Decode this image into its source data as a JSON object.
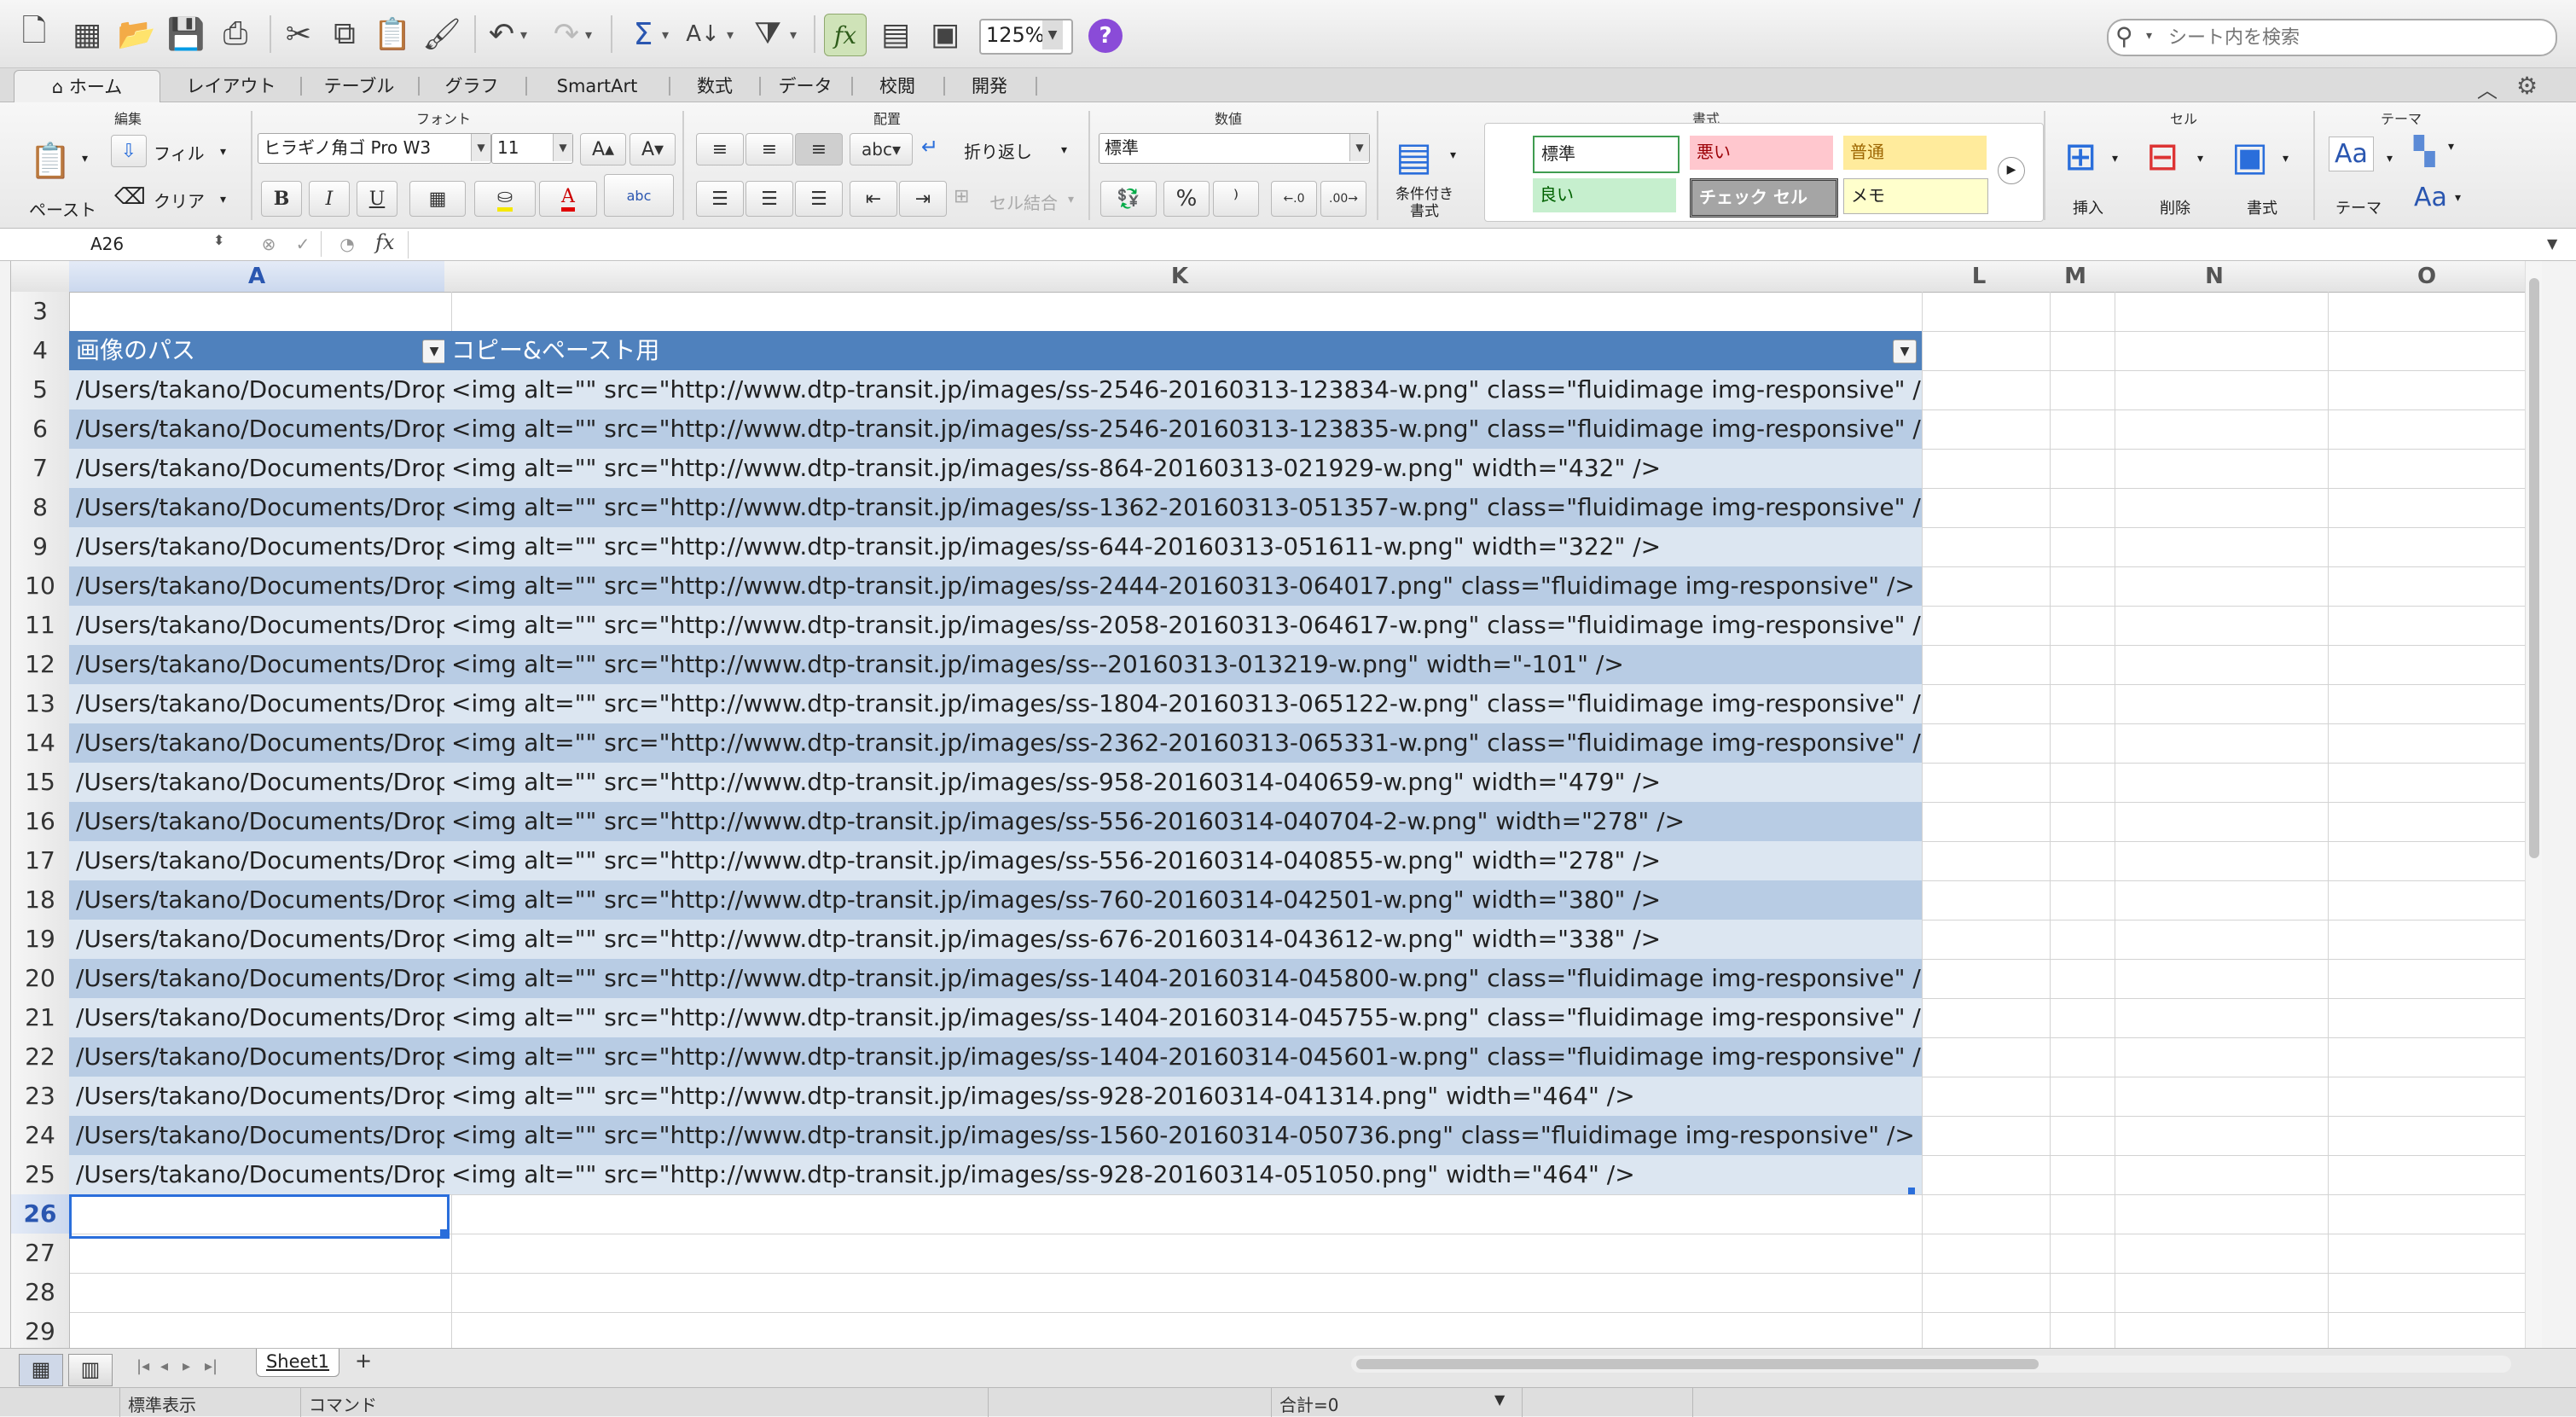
{
  "toolbar": {
    "zoom": "125%",
    "search_placeholder": "シート内を検索",
    "help": "?"
  },
  "tabs": [
    "ホーム",
    "レイアウト",
    "テーブル",
    "グラフ",
    "SmartArt",
    "数式",
    "データ",
    "校閲",
    "開発"
  ],
  "ribbon": {
    "groups": {
      "edit": "編集",
      "font": "フォント",
      "align": "配置",
      "number": "数値",
      "format": "書式",
      "cells": "セル",
      "theme": "テーマ"
    },
    "paste": "ペースト",
    "fill": "フィル",
    "clear": "クリア",
    "font_name": "ヒラギノ角ゴ Pro W3",
    "font_size": "11",
    "wrap": "折り返し",
    "merge": "セル結合",
    "number_format": "標準",
    "cond_format": "条件付き\n書式",
    "styles": {
      "normal": "標準",
      "bad": "悪い",
      "neutral": "普通",
      "good": "良い",
      "check": "チェック セル",
      "memo": "メモ"
    },
    "insert": "挿入",
    "delete": "削除",
    "format_btn": "書式",
    "theme_btn": "テーマ",
    "abc": "abc"
  },
  "formula_bar": {
    "name_box": "A26",
    "formula": ""
  },
  "columns": [
    "A",
    "K",
    "L",
    "M",
    "N",
    "O"
  ],
  "rows": [
    {
      "num": "3"
    },
    {
      "num": "4",
      "header": true,
      "a": "画像のパス",
      "k": "コピー&ペースト用"
    },
    {
      "num": "5",
      "a": "/Users/takano/Documents/Dropbox",
      "k": "<img alt=\"\" src=\"http://www.dtp-transit.jp/images/ss-2546-20160313-123834-w.png\" class=\"fluidimage img-responsive\" />"
    },
    {
      "num": "6",
      "a": "/Users/takano/Documents/Dropbox",
      "k": "<img alt=\"\" src=\"http://www.dtp-transit.jp/images/ss-2546-20160313-123835-w.png\" class=\"fluidimage img-responsive\" />"
    },
    {
      "num": "7",
      "a": "/Users/takano/Documents/Dropbox",
      "k": "<img alt=\"\" src=\"http://www.dtp-transit.jp/images/ss-864-20160313-021929-w.png\" width=\"432\" />"
    },
    {
      "num": "8",
      "a": "/Users/takano/Documents/Dropbox",
      "k": "<img alt=\"\" src=\"http://www.dtp-transit.jp/images/ss-1362-20160313-051357-w.png\" class=\"fluidimage img-responsive\" />"
    },
    {
      "num": "9",
      "a": "/Users/takano/Documents/Dropbox",
      "k": "<img alt=\"\" src=\"http://www.dtp-transit.jp/images/ss-644-20160313-051611-w.png\" width=\"322\" />"
    },
    {
      "num": "10",
      "a": "/Users/takano/Documents/Dropbox",
      "k": "<img alt=\"\" src=\"http://www.dtp-transit.jp/images/ss-2444-20160313-064017.png\" class=\"fluidimage img-responsive\" />"
    },
    {
      "num": "11",
      "a": "/Users/takano/Documents/Dropbox",
      "k": "<img alt=\"\" src=\"http://www.dtp-transit.jp/images/ss-2058-20160313-064617-w.png\" class=\"fluidimage img-responsive\" />"
    },
    {
      "num": "12",
      "a": "/Users/takano/Documents/Dropbox",
      "k": "<img alt=\"\" src=\"http://www.dtp-transit.jp/images/ss--20160313-013219-w.png\" width=\"-101\" />"
    },
    {
      "num": "13",
      "a": "/Users/takano/Documents/Dropbox",
      "k": "<img alt=\"\" src=\"http://www.dtp-transit.jp/images/ss-1804-20160313-065122-w.png\" class=\"fluidimage img-responsive\" />"
    },
    {
      "num": "14",
      "a": "/Users/takano/Documents/Dropbox",
      "k": "<img alt=\"\" src=\"http://www.dtp-transit.jp/images/ss-2362-20160313-065331-w.png\" class=\"fluidimage img-responsive\" />"
    },
    {
      "num": "15",
      "a": "/Users/takano/Documents/Dropbox",
      "k": "<img alt=\"\" src=\"http://www.dtp-transit.jp/images/ss-958-20160314-040659-w.png\" width=\"479\" />"
    },
    {
      "num": "16",
      "a": "/Users/takano/Documents/Dropbox",
      "k": "<img alt=\"\" src=\"http://www.dtp-transit.jp/images/ss-556-20160314-040704-2-w.png\" width=\"278\" />"
    },
    {
      "num": "17",
      "a": "/Users/takano/Documents/Dropbox",
      "k": "<img alt=\"\" src=\"http://www.dtp-transit.jp/images/ss-556-20160314-040855-w.png\" width=\"278\" />"
    },
    {
      "num": "18",
      "a": "/Users/takano/Documents/Dropbox",
      "k": "<img alt=\"\" src=\"http://www.dtp-transit.jp/images/ss-760-20160314-042501-w.png\" width=\"380\" />"
    },
    {
      "num": "19",
      "a": "/Users/takano/Documents/Dropbox",
      "k": "<img alt=\"\" src=\"http://www.dtp-transit.jp/images/ss-676-20160314-043612-w.png\" width=\"338\" />"
    },
    {
      "num": "20",
      "a": "/Users/takano/Documents/Dropbox",
      "k": "<img alt=\"\" src=\"http://www.dtp-transit.jp/images/ss-1404-20160314-045800-w.png\" class=\"fluidimage img-responsive\" />"
    },
    {
      "num": "21",
      "a": "/Users/takano/Documents/Dropbox",
      "k": "<img alt=\"\" src=\"http://www.dtp-transit.jp/images/ss-1404-20160314-045755-w.png\" class=\"fluidimage img-responsive\" />"
    },
    {
      "num": "22",
      "a": "/Users/takano/Documents/Dropbox",
      "k": "<img alt=\"\" src=\"http://www.dtp-transit.jp/images/ss-1404-20160314-045601-w.png\" class=\"fluidimage img-responsive\" />"
    },
    {
      "num": "23",
      "a": "/Users/takano/Documents/Dropbox",
      "k": "<img alt=\"\" src=\"http://www.dtp-transit.jp/images/ss-928-20160314-041314.png\" width=\"464\" />"
    },
    {
      "num": "24",
      "a": "/Users/takano/Documents/Dropbox",
      "k": "<img alt=\"\" src=\"http://www.dtp-transit.jp/images/ss-1560-20160314-050736.png\" class=\"fluidimage img-responsive\" />"
    },
    {
      "num": "25",
      "a": "/Users/takano/Documents/Dropbox",
      "k": "<img alt=\"\" src=\"http://www.dtp-transit.jp/images/ss-928-20160314-051050.png\" width=\"464\" />"
    },
    {
      "num": "26",
      "active": true
    },
    {
      "num": "27"
    },
    {
      "num": "28"
    },
    {
      "num": "29"
    }
  ],
  "sheet_tab": "Sheet1",
  "add_sheet": "+",
  "status": {
    "view": "標準表示",
    "mode": "コマンド",
    "sum": "合計=0"
  }
}
